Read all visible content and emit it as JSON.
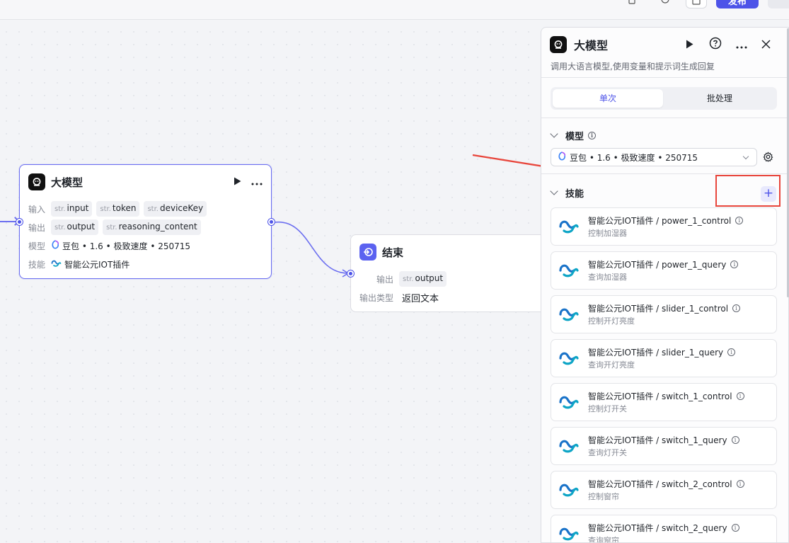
{
  "topbar": {
    "publish_label": "发布"
  },
  "llm_node": {
    "title": "大模型",
    "input_label": "输入",
    "inputs": [
      {
        "type": "str.",
        "name": "input"
      },
      {
        "type": "str.",
        "name": "token"
      },
      {
        "type": "str.",
        "name": "deviceKey"
      }
    ],
    "output_label": "输出",
    "outputs": [
      {
        "type": "str.",
        "name": "output"
      },
      {
        "type": "str.",
        "name": "reasoning_content"
      }
    ],
    "model_label": "模型",
    "model_value": "豆包 • 1.6 • 极致速度 • 250715",
    "skill_label": "技能",
    "skill_value": "智能公元IOT插件"
  },
  "end_node": {
    "title": "结束",
    "output_label": "输出",
    "output": {
      "type": "str.",
      "name": "output"
    },
    "output_type_label": "输出类型",
    "output_type_value": "返回文本"
  },
  "panel": {
    "title": "大模型",
    "description": "调用大语言模型,使用变量和提示词生成回复",
    "tabs": [
      "单次",
      "批处理"
    ],
    "active_tab": "单次",
    "model_section_label": "模型",
    "model_value": "豆包 • 1.6 • 极致速度 • 250715",
    "skills_section_label": "技能",
    "add_label": "+",
    "skills": [
      {
        "name": "智能公元IOT插件 / power_1_control",
        "desc": "控制加湿器"
      },
      {
        "name": "智能公元IOT插件 / power_1_query",
        "desc": "查询加湿器"
      },
      {
        "name": "智能公元IOT插件 / slider_1_control",
        "desc": "控制开灯亮度"
      },
      {
        "name": "智能公元IOT插件 / slider_1_query",
        "desc": "查询开灯亮度"
      },
      {
        "name": "智能公元IOT插件 / switch_1_control",
        "desc": "控制灯开关"
      },
      {
        "name": "智能公元IOT插件 / switch_1_query",
        "desc": "查询灯开关"
      },
      {
        "name": "智能公元IOT插件 / switch_2_control",
        "desc": "控制窗帘"
      },
      {
        "name": "智能公元IOT插件 / switch_2_query",
        "desc": "查询窗帘"
      }
    ]
  },
  "colors": {
    "accent": "#4d53e8",
    "annotation_red": "#e8463c"
  }
}
